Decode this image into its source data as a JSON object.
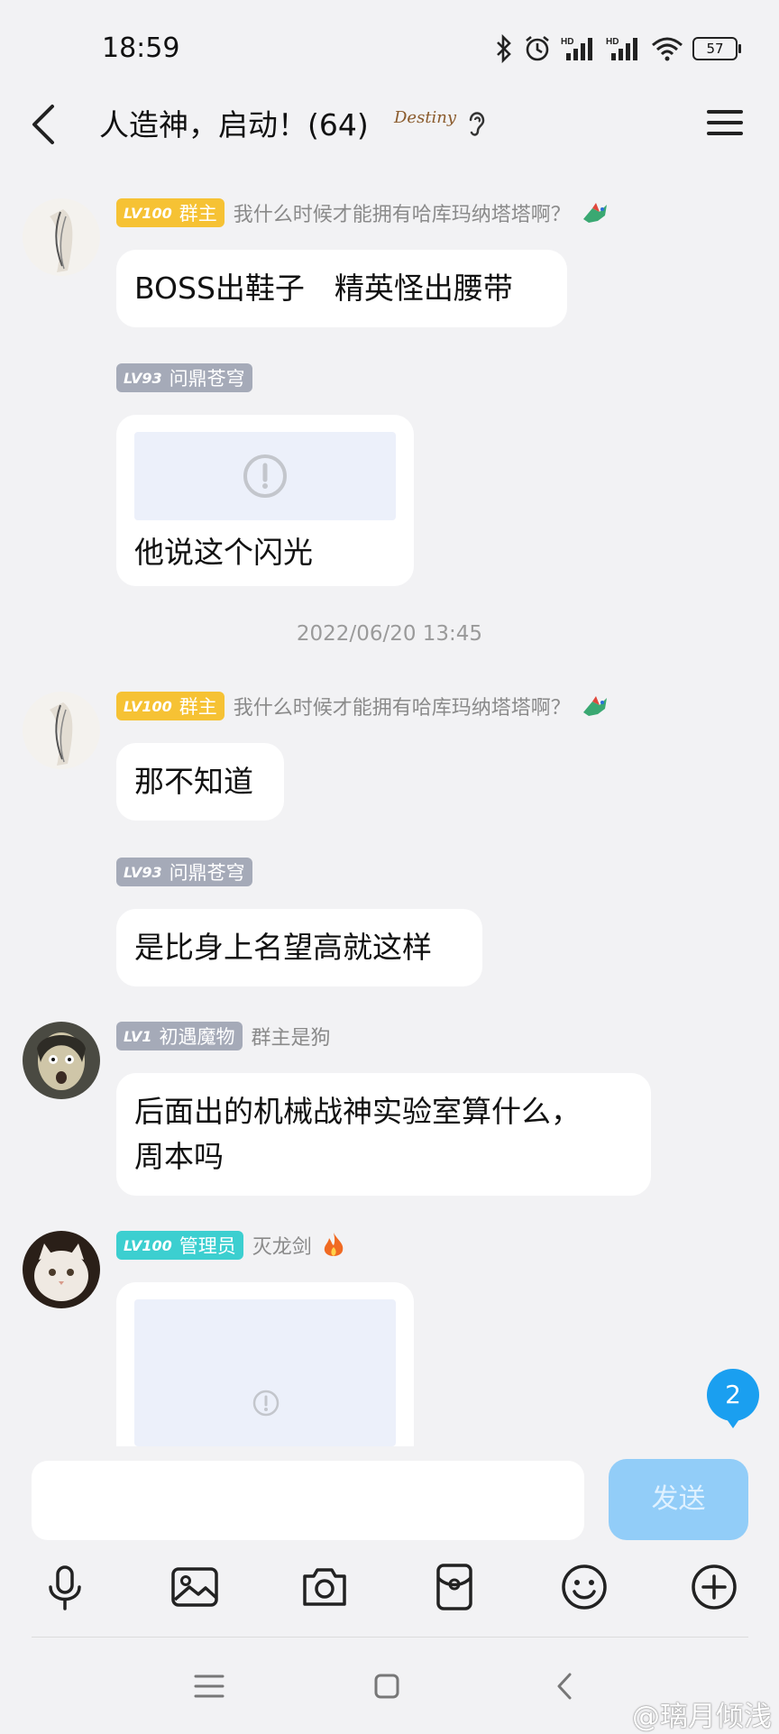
{
  "status_bar": {
    "time": "18:59",
    "battery": "57"
  },
  "header": {
    "title": "人造神，启动！(64)",
    "badge": "Destiny"
  },
  "messages": [
    {
      "level": "LV100",
      "role": "群主",
      "title": "我什么时候才能拥有哈库玛纳塔塔啊？",
      "text": "BOSS出鞋子　精英怪出腰带"
    },
    {
      "level": "LV93",
      "name": "问鼎苍穹",
      "text": "他说这个闪光"
    },
    {
      "level": "LV100",
      "role": "群主",
      "title": "我什么时候才能拥有哈库玛纳塔塔啊？",
      "text": "那不知道"
    },
    {
      "level": "LV93",
      "name": "问鼎苍穹",
      "text": "是比身上名望高就这样"
    },
    {
      "level": "LV1",
      "role": "初遇魔物",
      "title": "群主是狗",
      "text_lines": [
        "后面出的机械战神实验室算什么，",
        "周本吗"
      ]
    },
    {
      "level": "LV100",
      "role": "管理员",
      "title": "灭龙剑"
    }
  ],
  "timestamp": "2022/06/20 13:45",
  "unread_count": "2",
  "composer": {
    "placeholder": "",
    "send_label": "发送"
  },
  "watermark": "@璃月倾浅",
  "colors": {
    "owner_tag": "#f6c234",
    "member_tag": "#a5aab8",
    "admin_tag": "#3ccfd0",
    "send_button": "#92cdf8",
    "unread_badge": "#1a9ff0"
  }
}
